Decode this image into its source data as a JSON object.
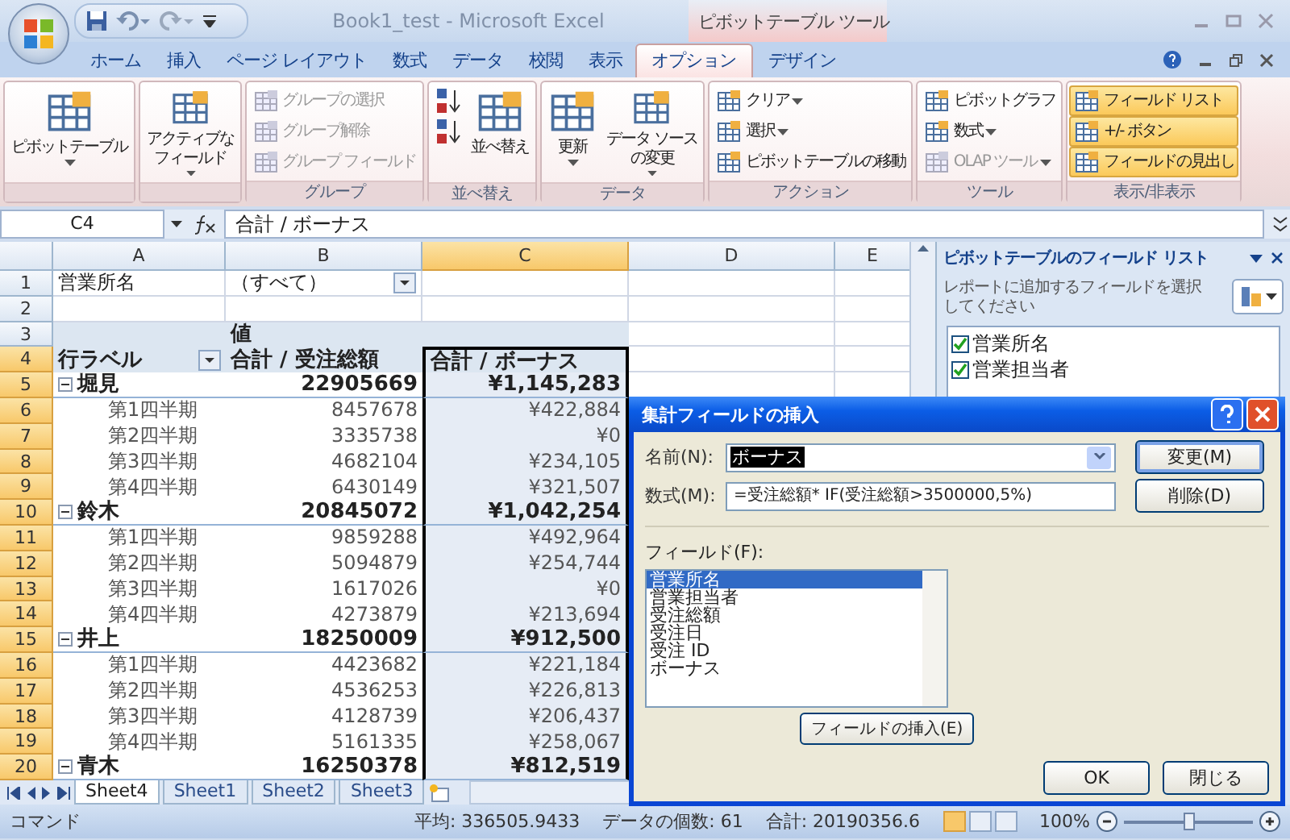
{
  "title_bar": {
    "title": "Book1_test - Microsoft Excel",
    "context_group": "ピボットテーブル ツール"
  },
  "ribbon_tabs": [
    {
      "label": "ホーム",
      "selected": false,
      "contextual": false
    },
    {
      "label": "挿入",
      "selected": false,
      "contextual": false
    },
    {
      "label": "ページ レイアウト",
      "selected": false,
      "contextual": false
    },
    {
      "label": "数式",
      "selected": false,
      "contextual": false
    },
    {
      "label": "データ",
      "selected": false,
      "contextual": false
    },
    {
      "label": "校閲",
      "selected": false,
      "contextual": false
    },
    {
      "label": "表示",
      "selected": false,
      "contextual": false
    },
    {
      "label": "オプション",
      "selected": true,
      "contextual": true
    },
    {
      "label": "デザイン",
      "selected": false,
      "contextual": true
    }
  ],
  "ribbon_groups": [
    {
      "items": [
        {
          "kind": "large",
          "lines": [
            "ピボットテーブル"
          ],
          "menu": true,
          "disabled": false,
          "active": false
        }
      ]
    },
    {
      "items": [
        {
          "kind": "large",
          "lines": [
            "アクティブな",
            "フィールド"
          ],
          "menu": true,
          "disabled": false,
          "active": false
        }
      ]
    },
    {
      "label": "グループ",
      "items": [
        {
          "kind": "small",
          "lines": [
            "グループの選択"
          ],
          "menu": false,
          "disabled": true,
          "active": false
        },
        {
          "kind": "small",
          "lines": [
            "グループ解除"
          ],
          "menu": false,
          "disabled": true,
          "active": false
        },
        {
          "kind": "small",
          "lines": [
            "グループ フィールド"
          ],
          "menu": false,
          "disabled": true,
          "active": false
        }
      ]
    },
    {
      "label": "並べ替え",
      "items": [
        {
          "kind": "icon",
          "menu": false,
          "disabled": false,
          "active": false
        },
        {
          "kind": "icon",
          "menu": false,
          "disabled": false,
          "active": false
        },
        {
          "kind": "large",
          "lines": [
            "並べ替え"
          ],
          "menu": false,
          "disabled": false,
          "active": false
        }
      ]
    },
    {
      "label": "データ",
      "items": [
        {
          "kind": "large",
          "lines": [
            "更新"
          ],
          "menu": true,
          "disabled": false,
          "active": false
        },
        {
          "kind": "large",
          "lines": [
            "データ ソース",
            "の変更"
          ],
          "menu": true,
          "disabled": false,
          "active": false
        }
      ]
    },
    {
      "label": "アクション",
      "items": [
        {
          "kind": "small",
          "lines": [
            "クリア"
          ],
          "menu": true,
          "disabled": false,
          "active": false
        },
        {
          "kind": "small",
          "lines": [
            "選択"
          ],
          "menu": true,
          "disabled": false,
          "active": false
        },
        {
          "kind": "small",
          "lines": [
            "ピボットテーブルの移動"
          ],
          "menu": false,
          "disabled": false,
          "active": false
        }
      ]
    },
    {
      "label": "ツール",
      "items": [
        {
          "kind": "small",
          "lines": [
            "ピボットグラフ"
          ],
          "menu": false,
          "disabled": false,
          "active": false
        },
        {
          "kind": "small",
          "lines": [
            "数式"
          ],
          "menu": true,
          "disabled": false,
          "active": false
        },
        {
          "kind": "small",
          "lines": [
            "OLAP ツール"
          ],
          "menu": true,
          "disabled": true,
          "active": false
        }
      ]
    },
    {
      "label": "表示/非表示",
      "items": [
        {
          "kind": "small",
          "lines": [
            "フィールド リスト"
          ],
          "menu": false,
          "disabled": false,
          "active": true
        },
        {
          "kind": "small",
          "lines": [
            "+/- ボタン"
          ],
          "menu": false,
          "disabled": false,
          "active": true
        },
        {
          "kind": "small",
          "lines": [
            "フィールドの見出し"
          ],
          "menu": false,
          "disabled": false,
          "active": true
        }
      ]
    }
  ],
  "formula_bar": {
    "name_box": "C4",
    "formula": "合計 / ボーナス"
  },
  "sheet": {
    "columns": [
      {
        "label": "A",
        "selected": false
      },
      {
        "label": "B",
        "selected": false
      },
      {
        "label": "C",
        "selected": true
      },
      {
        "label": "D",
        "selected": false
      },
      {
        "label": "E",
        "selected": false
      }
    ],
    "rows": [
      {
        "number": "1",
        "kind": "filter",
        "selected": false,
        "label": "営業所名",
        "value": "（すべて）"
      },
      {
        "number": "2",
        "kind": "blank",
        "selected": false
      },
      {
        "number": "3",
        "kind": "values_header",
        "selected": false,
        "value": "値"
      },
      {
        "number": "4",
        "kind": "header",
        "selected": true,
        "label": "行ラベル",
        "total": "合計 / 受注総額",
        "bonus": "合計 / ボーナス"
      },
      {
        "number": "5",
        "kind": "group",
        "selected": true,
        "expanded": true,
        "label": "堀見",
        "total": "22905669",
        "bonus": "¥1,145,283"
      },
      {
        "number": "6",
        "kind": "item",
        "selected": true,
        "label": "第1四半期",
        "total": "8457678",
        "bonus": "¥422,884"
      },
      {
        "number": "7",
        "kind": "item",
        "selected": true,
        "label": "第2四半期",
        "total": "3335738",
        "bonus": "¥0"
      },
      {
        "number": "8",
        "kind": "item",
        "selected": true,
        "label": "第3四半期",
        "total": "4682104",
        "bonus": "¥234,105"
      },
      {
        "number": "9",
        "kind": "item",
        "selected": true,
        "label": "第4四半期",
        "total": "6430149",
        "bonus": "¥321,507"
      },
      {
        "number": "10",
        "kind": "group",
        "selected": true,
        "expanded": true,
        "label": "鈴木",
        "total": "20845072",
        "bonus": "¥1,042,254"
      },
      {
        "number": "11",
        "kind": "item",
        "selected": true,
        "label": "第1四半期",
        "total": "9859288",
        "bonus": "¥492,964"
      },
      {
        "number": "12",
        "kind": "item",
        "selected": true,
        "label": "第2四半期",
        "total": "5094879",
        "bonus": "¥254,744"
      },
      {
        "number": "13",
        "kind": "item",
        "selected": true,
        "label": "第3四半期",
        "total": "1617026",
        "bonus": "¥0"
      },
      {
        "number": "14",
        "kind": "item",
        "selected": true,
        "label": "第4四半期",
        "total": "4273879",
        "bonus": "¥213,694"
      },
      {
        "number": "15",
        "kind": "group",
        "selected": true,
        "expanded": true,
        "label": "井上",
        "total": "18250009",
        "bonus": "¥912,500"
      },
      {
        "number": "16",
        "kind": "item",
        "selected": true,
        "label": "第1四半期",
        "total": "4423682",
        "bonus": "¥221,184"
      },
      {
        "number": "17",
        "kind": "item",
        "selected": true,
        "label": "第2四半期",
        "total": "4536253",
        "bonus": "¥226,813"
      },
      {
        "number": "18",
        "kind": "item",
        "selected": true,
        "label": "第3四半期",
        "total": "4128739",
        "bonus": "¥206,437"
      },
      {
        "number": "19",
        "kind": "item",
        "selected": true,
        "label": "第4四半期",
        "total": "5161335",
        "bonus": "¥258,067"
      },
      {
        "number": "20",
        "kind": "group",
        "selected": true,
        "expanded": true,
        "label": "青木",
        "total": "16250378",
        "bonus": "¥812,519"
      }
    ],
    "tabs": [
      {
        "label": "Sheet4",
        "selected": true
      },
      {
        "label": "Sheet1",
        "selected": false
      },
      {
        "label": "Sheet2",
        "selected": false
      },
      {
        "label": "Sheet3",
        "selected": false
      }
    ]
  },
  "field_list_pane": {
    "title": "ピボットテーブルのフィールド リスト",
    "instruction": [
      "レポートに追加するフィールドを選択",
      "してください"
    ],
    "fields": [
      {
        "label": "営業所名",
        "checked": true
      },
      {
        "label": "営業担当者",
        "checked": true
      }
    ]
  },
  "dialog": {
    "title": "集計フィールドの挿入",
    "name_label": "名前(N):",
    "name_value": "ボーナス",
    "name_value_selected": true,
    "formula_label": "数式(M):",
    "formula_value": "=受注総額* IF(受注総額>3500000,5%)",
    "modify_button": "変更(M)",
    "delete_button": "削除(D)",
    "fields_label": "フィールド(F):",
    "fields": [
      {
        "label": "営業所名",
        "selected": true
      },
      {
        "label": "営業担当者",
        "selected": false
      },
      {
        "label": "受注総額",
        "selected": false
      },
      {
        "label": "受注日",
        "selected": false
      },
      {
        "label": "受注 ID",
        "selected": false
      },
      {
        "label": "ボーナス",
        "selected": false
      }
    ],
    "insert_button": "フィールドの挿入(E)",
    "ok_button": "OK",
    "close_button": "閉じる"
  },
  "status_bar": {
    "mode": "コマンド",
    "average": "平均: 336505.9433",
    "count": "データの個数: 61",
    "sum": "合計: 20190356.6",
    "views": [
      {
        "selected": true
      },
      {
        "selected": false
      },
      {
        "selected": false
      }
    ],
    "zoom": "100%",
    "zoom_slider": {
      "level": 0.5
    }
  }
}
